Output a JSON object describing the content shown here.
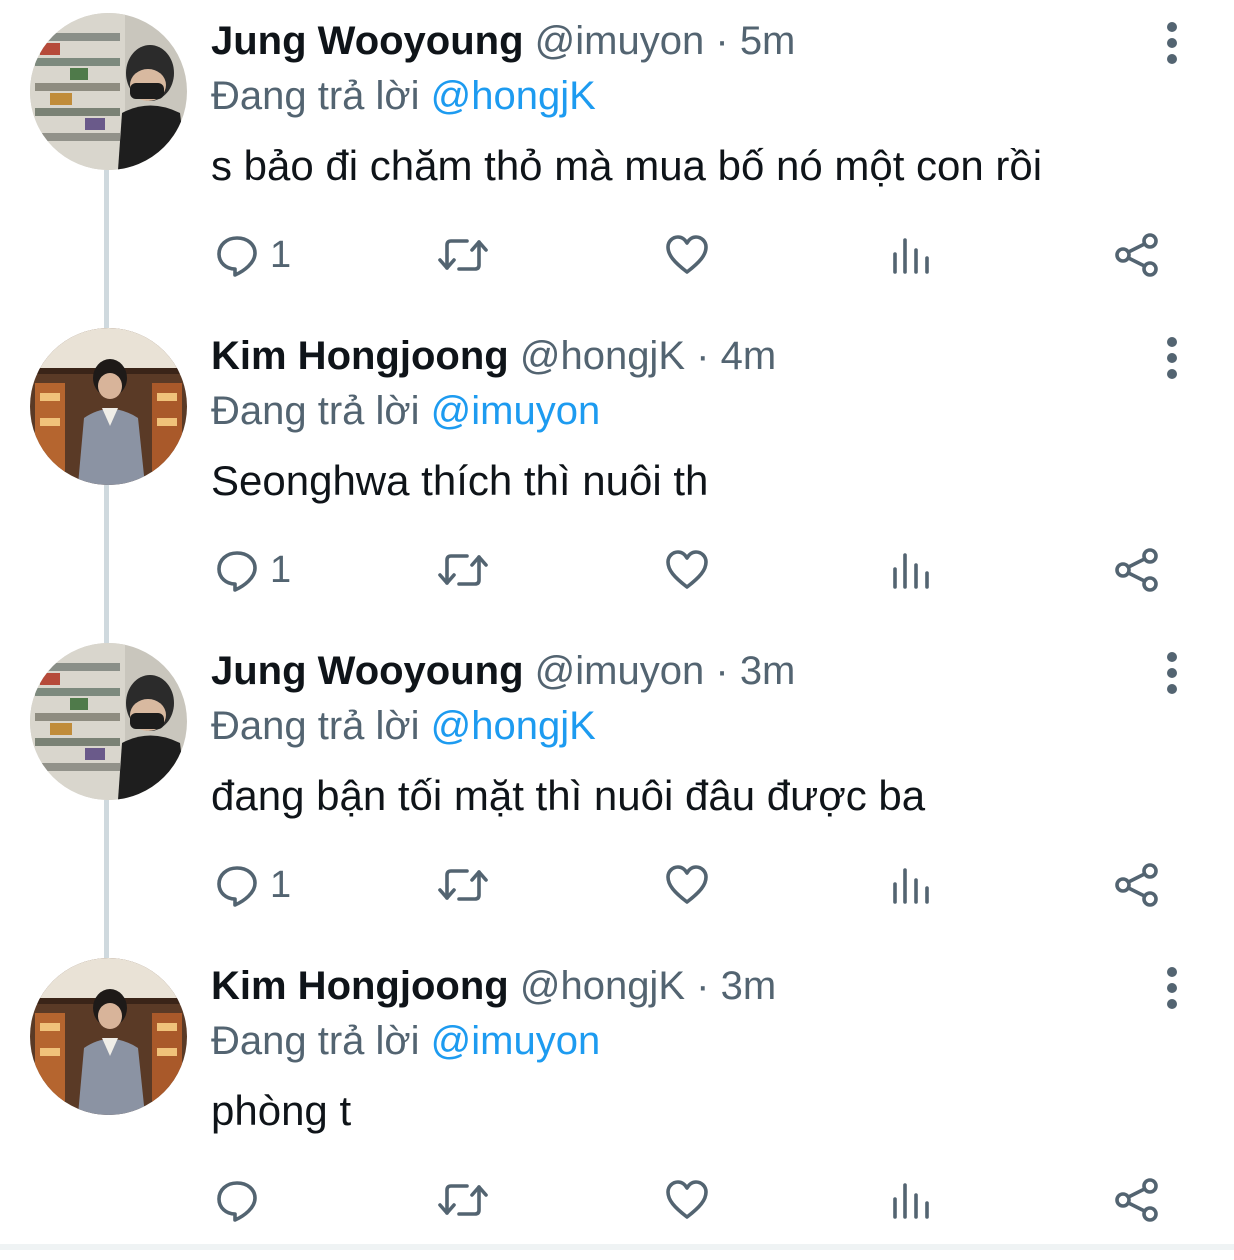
{
  "colors": {
    "text": "#0f1419",
    "muted": "#536471",
    "mention": "#1d9bf0",
    "thread_line": "#cfd9de"
  },
  "icons": {
    "reply": "reply-icon",
    "retweet": "retweet-icon",
    "like": "heart-icon",
    "views": "analytics-icon",
    "share": "share-icon",
    "more": "more-vertical-icon"
  },
  "tweets": [
    {
      "name": "Jung Wooyoung",
      "handle": "@imuyon",
      "separator": "·",
      "time": "5m",
      "replying_label": "Đang trả lời",
      "replying_to": "@hongjK",
      "text": "s bảo đi chăm thỏ mà mua bố nó một con rồi",
      "reply_count": "1"
    },
    {
      "name": "Kim Hongjoong",
      "handle": "@hongjK",
      "separator": "·",
      "time": "4m",
      "replying_label": "Đang trả lời",
      "replying_to": "@imuyon",
      "text": "Seonghwa thích thì nuôi th",
      "reply_count": "1"
    },
    {
      "name": "Jung Wooyoung",
      "handle": "@imuyon",
      "separator": "·",
      "time": "3m",
      "replying_label": "Đang trả lời",
      "replying_to": "@hongjK",
      "text": "đang bận tối mặt thì nuôi đâu được ba",
      "reply_count": "1"
    },
    {
      "name": "Kim Hongjoong",
      "handle": "@hongjK",
      "separator": "·",
      "time": "3m",
      "replying_label": "Đang trả lời",
      "replying_to": "@imuyon",
      "text": "phòng t",
      "reply_count": ""
    }
  ]
}
